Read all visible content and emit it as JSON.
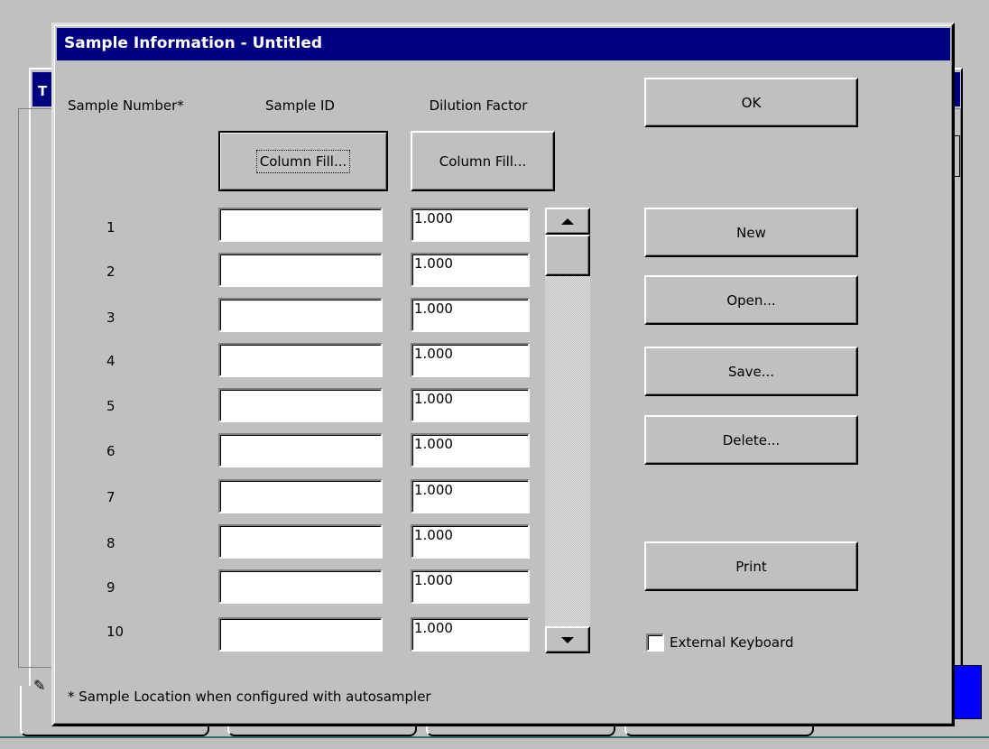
{
  "background": {
    "title_fragment": "T"
  },
  "dialog": {
    "title": "Sample Information - Untitled",
    "headers": {
      "sample_number": "Sample Number*",
      "sample_id": "Sample ID",
      "dilution_factor": "Dilution Factor"
    },
    "column_fill_id_label": "Column Fill...",
    "column_fill_dilution_label": "Column Fill...",
    "rows": [
      {
        "number": "1",
        "sample_id": "",
        "dilution": "1.000"
      },
      {
        "number": "2",
        "sample_id": "",
        "dilution": "1.000"
      },
      {
        "number": "3",
        "sample_id": "",
        "dilution": "1.000"
      },
      {
        "number": "4",
        "sample_id": "",
        "dilution": "1.000"
      },
      {
        "number": "5",
        "sample_id": "",
        "dilution": "1.000"
      },
      {
        "number": "6",
        "sample_id": "",
        "dilution": "1.000"
      },
      {
        "number": "7",
        "sample_id": "",
        "dilution": "1.000"
      },
      {
        "number": "8",
        "sample_id": "",
        "dilution": "1.000"
      },
      {
        "number": "9",
        "sample_id": "",
        "dilution": "1.000"
      },
      {
        "number": "10",
        "sample_id": "",
        "dilution": "1.000"
      }
    ],
    "buttons": {
      "ok": "OK",
      "new": "New",
      "open": "Open...",
      "save": "Save...",
      "delete": "Delete...",
      "print": "Print"
    },
    "external_keyboard": {
      "label": "External Keyboard",
      "checked": false
    },
    "footnote": "* Sample Location when configured with autosampler"
  },
  "colors": {
    "titlebar": "#000080",
    "face": "#c0c0c0"
  }
}
